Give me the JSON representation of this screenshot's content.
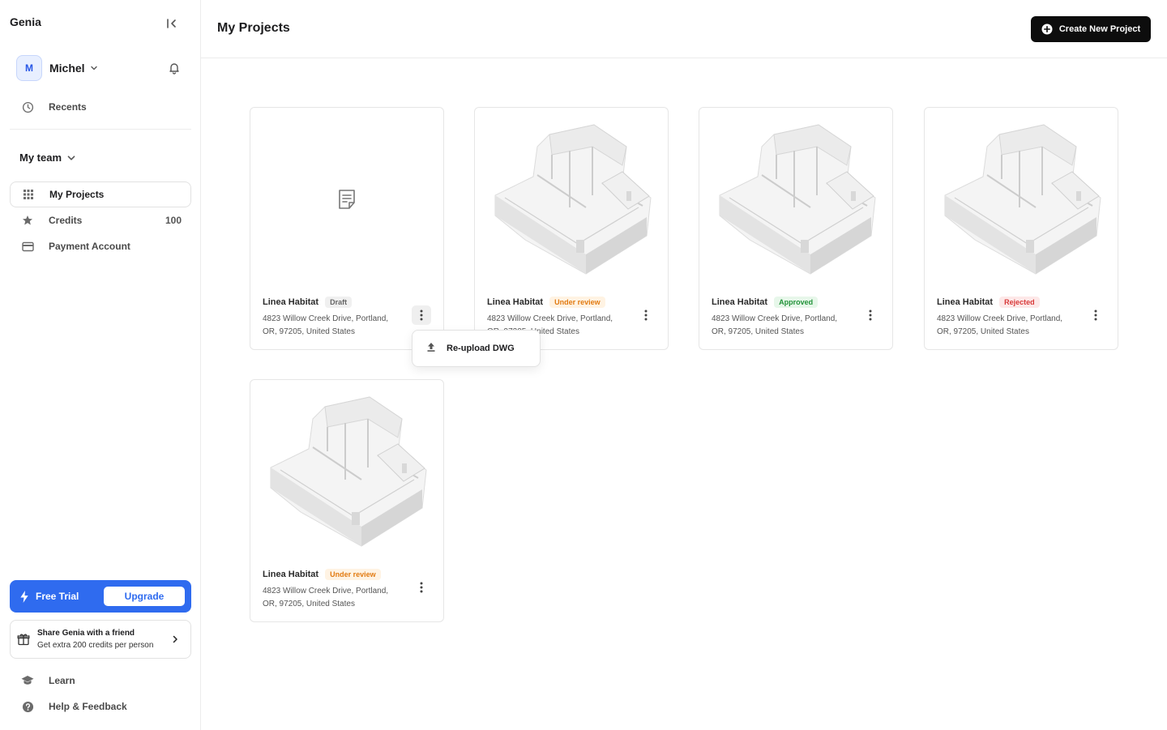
{
  "sidebar": {
    "brand": "Genia",
    "user": {
      "initial": "M",
      "name": "Michel"
    },
    "recents_label": "Recents",
    "team_label": "My team",
    "items": [
      {
        "label": "My Projects",
        "icon": "grid-icon",
        "active": true
      },
      {
        "label": "Credits",
        "icon": "star-icon",
        "count": "100"
      },
      {
        "label": "Payment Account",
        "icon": "credit-card-icon"
      }
    ],
    "trial": {
      "label": "Free Trial",
      "upgrade_label": "Upgrade"
    },
    "share": {
      "title": "Share Genia with a friend",
      "subtitle": "Get extra 200 credits per person"
    },
    "bottom": [
      {
        "label": "Learn",
        "icon": "graduation-cap-icon"
      },
      {
        "label": "Help & Feedback",
        "icon": "help-circle-icon"
      }
    ]
  },
  "header": {
    "title": "My Projects",
    "create_label": "Create New Project"
  },
  "projects": [
    {
      "name": "Linea Habitat",
      "status": "Draft",
      "address_line1": "4823 Willow Creek Drive, Portland,",
      "address_line2": "OR, 97205, United States",
      "has_thumbnail": false
    },
    {
      "name": "Linea Habitat",
      "status": "Under review",
      "address_line1": "4823 Willow Creek Drive, Portland,",
      "address_line2": "OR, 97205, United States",
      "has_thumbnail": true
    },
    {
      "name": "Linea Habitat",
      "status": "Approved",
      "address_line1": "4823 Willow Creek Drive, Portland,",
      "address_line2": "OR, 97205, United States",
      "has_thumbnail": true
    },
    {
      "name": "Linea Habitat",
      "status": "Rejected",
      "address_line1": "4823 Willow Creek Drive, Portland,",
      "address_line2": "OR, 97205, United States",
      "has_thumbnail": true
    },
    {
      "name": "Linea Habitat",
      "status": "Under review",
      "address_line1": "4823 Willow Creek Drive, Portland,",
      "address_line2": "OR, 97205, United States",
      "has_thumbnail": true
    }
  ],
  "context_menu": {
    "label": "Re-upload DWG",
    "icon": "upload-icon"
  },
  "colors": {
    "accent": "#2f6bef",
    "review": "#e27b12",
    "approved": "#23933a",
    "rejected": "#d83a3a"
  }
}
